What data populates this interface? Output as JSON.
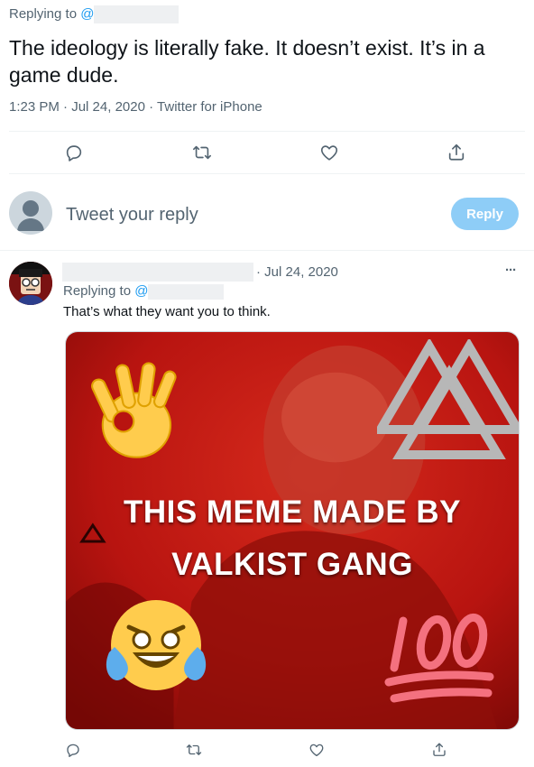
{
  "tweet": {
    "replying_to_label": "Replying to",
    "replying_to_at": "@",
    "text": "The ideology is literally fake. It doesn’t exist. It’s in a game dude.",
    "time": "1:23 PM",
    "sep1": "·",
    "date": "Jul 24, 2020",
    "sep2": "·",
    "source": "Twitter for iPhone"
  },
  "composer": {
    "placeholder": "Tweet your reply",
    "reply_button": "Reply"
  },
  "reply": {
    "date_prefix": "· Jul 24, 2020",
    "more": "···",
    "replying_to_label": "Replying to",
    "replying_to_at": "@",
    "text": "That’s what they want you to think."
  },
  "meme": {
    "line1": "THIS MEME MADE BY",
    "line2": "VALKIST GANG",
    "background_color": "#b81410"
  },
  "icons": [
    "reply-icon",
    "retweet-icon",
    "like-icon",
    "share-icon",
    "ok-hand-emoji",
    "valknut-symbol",
    "laughing-emoji",
    "hundred-emoji"
  ],
  "colors": {
    "link": "#1d9bf0",
    "muted": "#536471",
    "reply_button": "#8ecdf7"
  }
}
